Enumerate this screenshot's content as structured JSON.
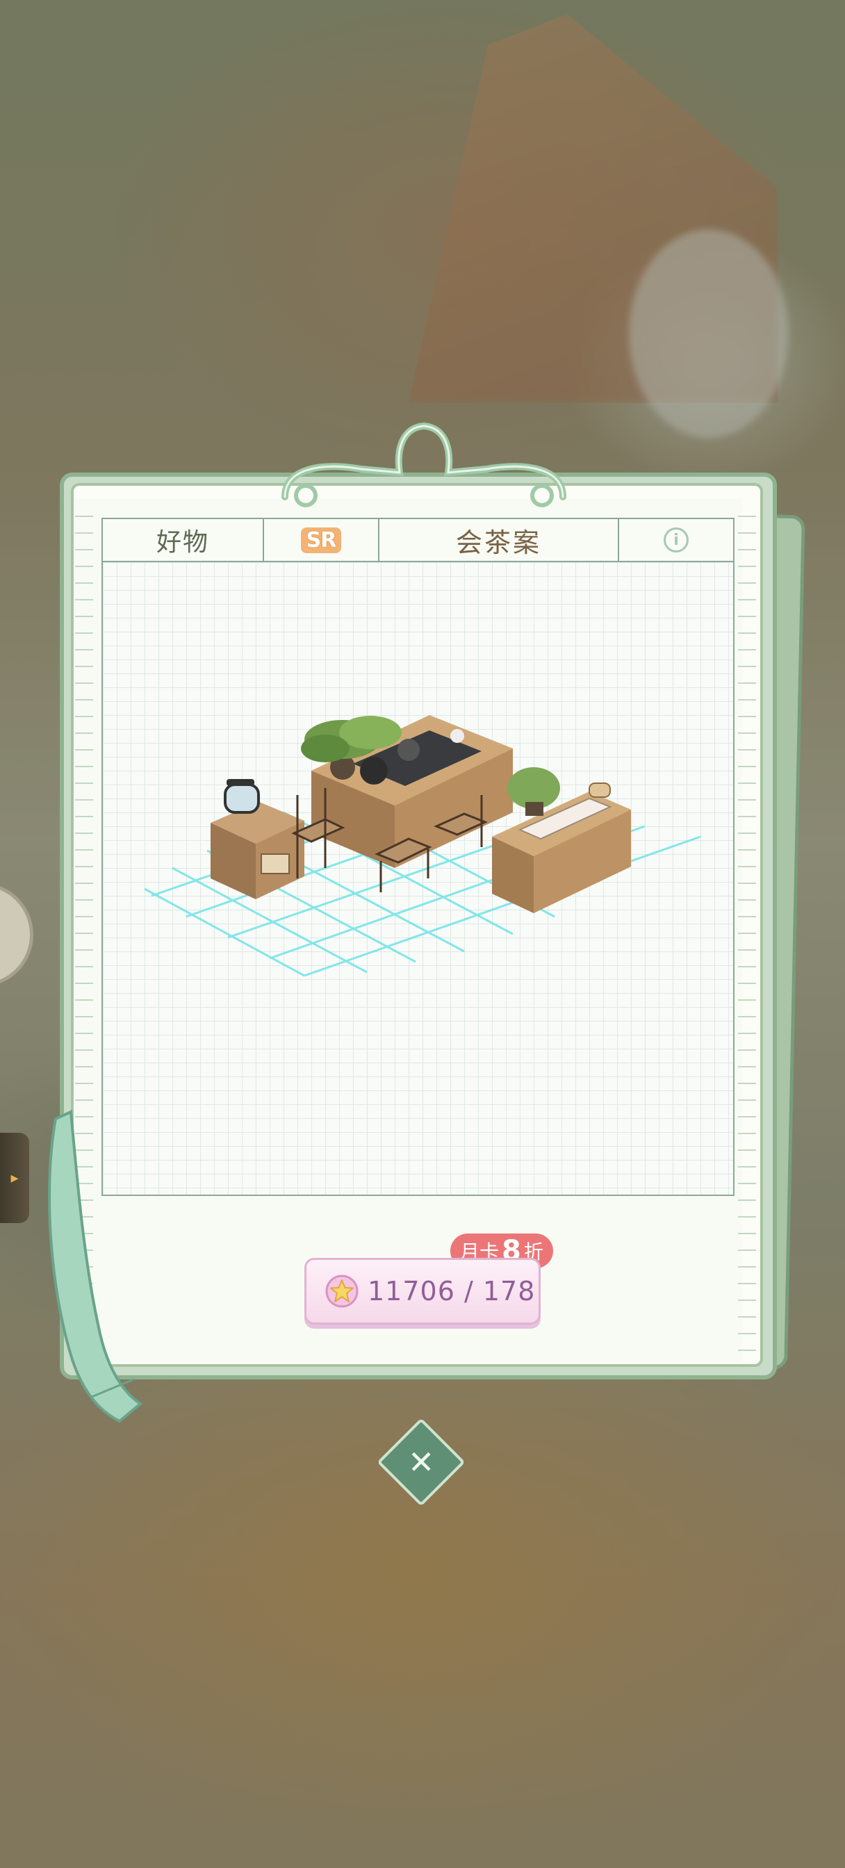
{
  "item": {
    "category": "好物",
    "rarity": "SR",
    "name": "会茶案"
  },
  "icons": {
    "info": "info-icon",
    "currency": "star-coin-icon",
    "close": "close-icon"
  },
  "price": {
    "text": "11706 / 178",
    "owned": 11706,
    "cost": 178,
    "discount_prefix": "月卡",
    "discount_value": "8",
    "discount_suffix": "折"
  },
  "colors": {
    "frame": "#8fb28f",
    "rarity_badge": "#f2b374",
    "price_text": "#8f5e98",
    "discount_badge": "#ec7677",
    "grid_highlight": "#6fe3e8"
  }
}
